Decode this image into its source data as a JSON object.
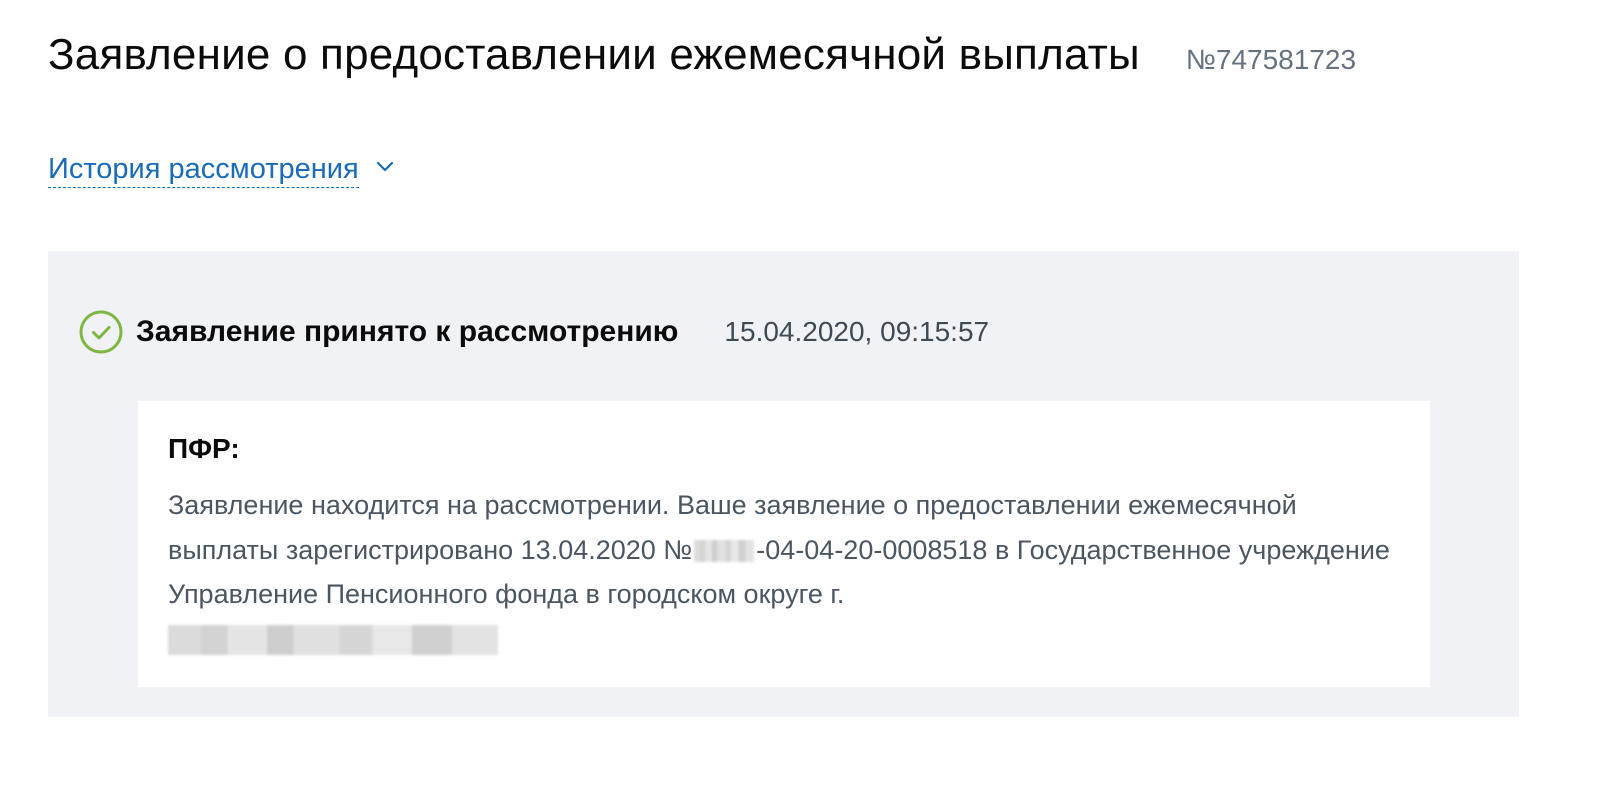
{
  "header": {
    "title": "Заявление о предоставлении ежемесячной выплаты",
    "number": "№747581723"
  },
  "history": {
    "label": "История рассмотрения",
    "icon": "chevron-down-icon"
  },
  "status": {
    "icon": "check-circle-icon",
    "title": "Заявление принято к рассмотрению",
    "timestamp": "15.04.2020, 09:15:57"
  },
  "message": {
    "org": "ПФР:",
    "text_part1": "Заявление находится на рассмотрении. Ваше заявление о предоставлении ежемесячной выплаты зарегистрировано 13.04.2020 №",
    "text_part2": "-04-04-20-0008518 в Государственное учреждение Управление Пенсионного фонда в городском округе г."
  },
  "colors": {
    "accent_link": "#1a6bb8",
    "success": "#7db742",
    "panel_bg": "#f1f2f5"
  }
}
